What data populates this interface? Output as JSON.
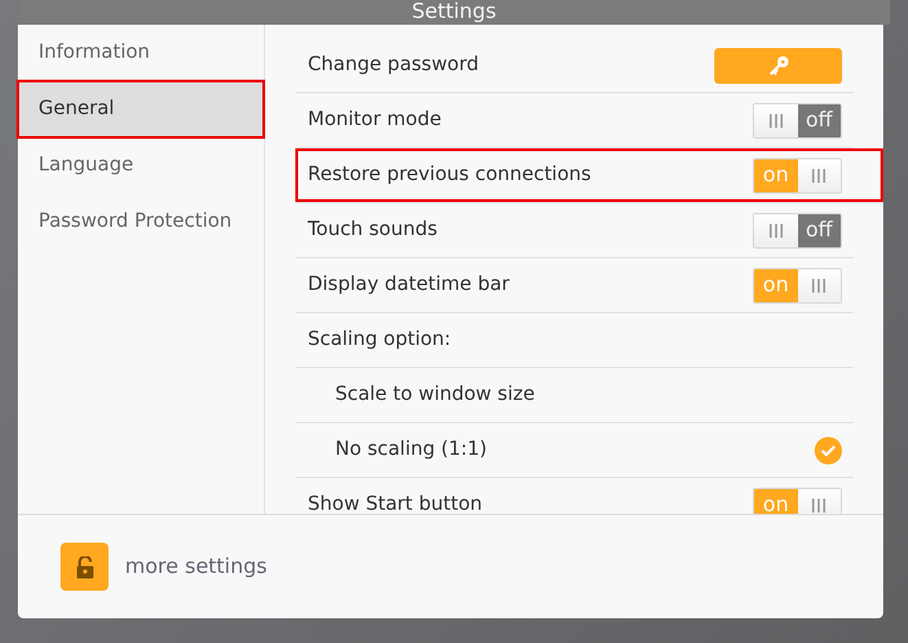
{
  "window": {
    "title": "Settings"
  },
  "sidebar": {
    "items": [
      {
        "label": "Information",
        "selected": false,
        "highlighted": false
      },
      {
        "label": "General",
        "selected": true,
        "highlighted": true
      },
      {
        "label": "Language",
        "selected": false,
        "highlighted": false
      },
      {
        "label": "Password Protection",
        "selected": false,
        "highlighted": false
      }
    ]
  },
  "settings": [
    {
      "kind": "button",
      "label": "Change password",
      "highlighted": false
    },
    {
      "kind": "toggle",
      "label": "Monitor mode",
      "on": false,
      "state_text": "off",
      "highlighted": false
    },
    {
      "kind": "toggle",
      "label": "Restore previous connections",
      "on": true,
      "state_text": "on",
      "highlighted": true
    },
    {
      "kind": "toggle",
      "label": "Touch sounds",
      "on": false,
      "state_text": "off",
      "highlighted": false
    },
    {
      "kind": "toggle",
      "label": "Display datetime bar",
      "on": true,
      "state_text": "on",
      "highlighted": false
    },
    {
      "kind": "heading",
      "label": "Scaling option:",
      "highlighted": false
    },
    {
      "kind": "option",
      "label": "Scale to window size",
      "selected": false,
      "highlighted": false
    },
    {
      "kind": "option",
      "label": "No scaling (1:1)",
      "selected": true,
      "highlighted": false
    },
    {
      "kind": "toggle",
      "label": "Show Start button",
      "on": true,
      "state_text": "on",
      "highlighted": false
    }
  ],
  "footer": {
    "label": "more settings"
  }
}
